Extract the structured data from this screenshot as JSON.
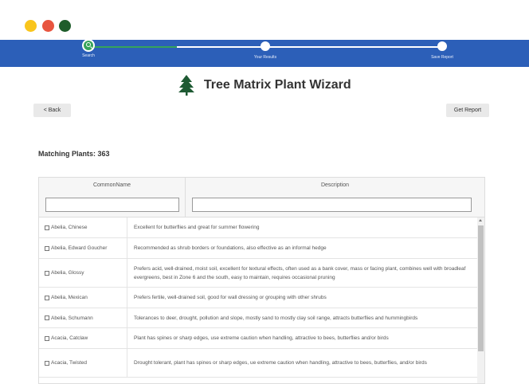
{
  "window": {
    "controls": [
      "minimize",
      "close",
      "maximize"
    ]
  },
  "colors": {
    "progress_bg": "#2c5fb8",
    "step_active": "#36a35a"
  },
  "steps": [
    {
      "label": "Search",
      "state": "active"
    },
    {
      "label": "Your Results",
      "state": "pending"
    },
    {
      "label": "Save Report",
      "state": "pending"
    }
  ],
  "header": {
    "title": "Tree Matrix Plant Wizard",
    "logo_icon": "tree-icon"
  },
  "toolbar": {
    "back_label": "<   Back",
    "report_label": "Get Report"
  },
  "results": {
    "matching_label": "Matching Plants: 363"
  },
  "table": {
    "columns": [
      "CommonName",
      "Description"
    ],
    "filters": {
      "name_value": "",
      "desc_value": ""
    },
    "rows": [
      {
        "name": "Abelia, Chinese",
        "description": "Excellent for butterflies and great for summer flowering"
      },
      {
        "name": "Abelia, Edward Goucher",
        "description": "Recommended as shrub borders or foundations, also effective as an informal hedge"
      },
      {
        "name": "Abelia, Glossy",
        "description": "Prefers acid, well-drained, moist soil, excellent for textural effects, often used as a bank cover, mass or facing plant, combines well with broadleaf evergreens, best in Zone 6 and the south, easy to maintain, requires occasional pruning"
      },
      {
        "name": "Abelia, Mexican",
        "description": "Prefers fertile, well-drained soil, good for wall dressing or grouping with other shrubs"
      },
      {
        "name": "Abelia, Schumann",
        "description": "Tolerances to deer, drought, pollution and slope, mostly sand to mostly clay soil range, attracts butterflies and hummingbirds"
      },
      {
        "name": "Acacia, Catclaw",
        "description": "Plant has spines or sharp edges, use extreme caution when handling, attractive to bees, butterflies and/or birds"
      },
      {
        "name": "Acacia, Twisted",
        "description": "Drought tolerant, plant has spines or sharp edges, ue extreme caution when handling, attractive to bees, butterflies, and/or birds"
      }
    ]
  }
}
